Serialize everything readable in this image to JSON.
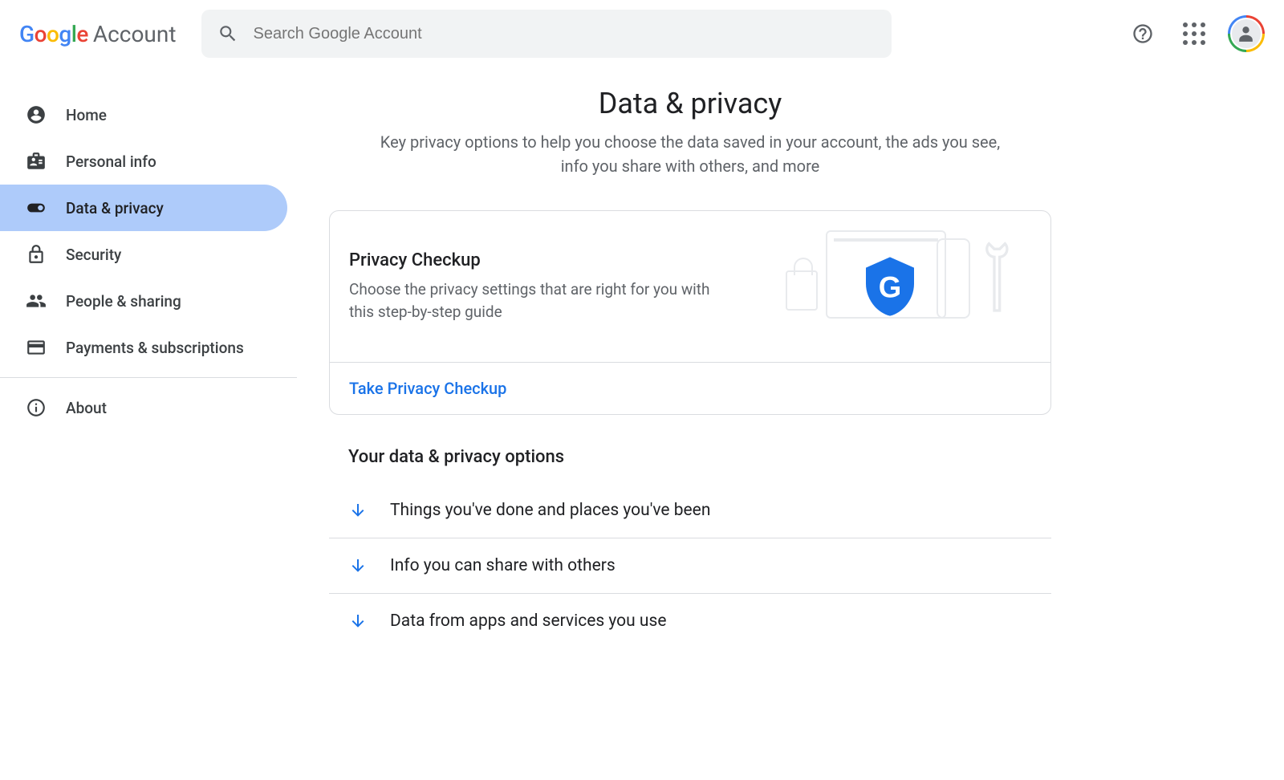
{
  "header": {
    "logo_google_letters": [
      "G",
      "o",
      "o",
      "g",
      "l",
      "e"
    ],
    "logo_account": "Account",
    "search_placeholder": "Search Google Account"
  },
  "sidebar": {
    "items": [
      {
        "label": "Home",
        "icon": "home"
      },
      {
        "label": "Personal info",
        "icon": "badge"
      },
      {
        "label": "Data & privacy",
        "icon": "toggle",
        "active": true
      },
      {
        "label": "Security",
        "icon": "lock"
      },
      {
        "label": "People & sharing",
        "icon": "people"
      },
      {
        "label": "Payments & subscriptions",
        "icon": "card"
      }
    ],
    "about_label": "About"
  },
  "main": {
    "title": "Data & privacy",
    "subtitle": "Key privacy options to help you choose the data saved in your account, the ads you see, info you share with others, and more",
    "privacy_card": {
      "title": "Privacy Checkup",
      "desc": "Choose the privacy settings that are right for you with this step-by-step guide",
      "link": "Take Privacy Checkup"
    },
    "options_heading": "Your data & privacy options",
    "options": [
      {
        "label": "Things you've done and places you've been"
      },
      {
        "label": "Info you can share with others"
      },
      {
        "label": "Data from apps and services you use"
      }
    ]
  }
}
